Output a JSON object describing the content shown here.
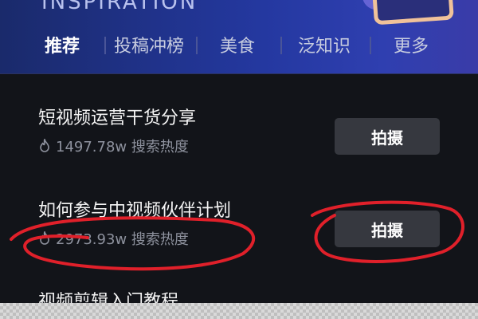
{
  "header": {
    "subtitle": "INSPIRATION",
    "tabs": [
      {
        "label": "推荐",
        "active": true
      },
      {
        "label": "投稿冲榜",
        "active": false
      },
      {
        "label": "美食",
        "active": false
      },
      {
        "label": "泛知识",
        "active": false
      },
      {
        "label": "更多",
        "active": false
      }
    ]
  },
  "list": {
    "items": [
      {
        "title": "短视频运营干货分享",
        "heat": "1497.78w 搜索热度",
        "button_label": "拍摄"
      },
      {
        "title": "如何参与中视频伙伴计划",
        "heat": "2973.93w 搜索热度",
        "button_label": "拍摄"
      },
      {
        "title": "视频剪辑入门教程"
      }
    ]
  },
  "icons": {
    "heat": "flame-icon"
  },
  "colors": {
    "background": "#121419",
    "banner": "#2438a0",
    "button": "#36383f",
    "annotation": "#e0202a"
  }
}
